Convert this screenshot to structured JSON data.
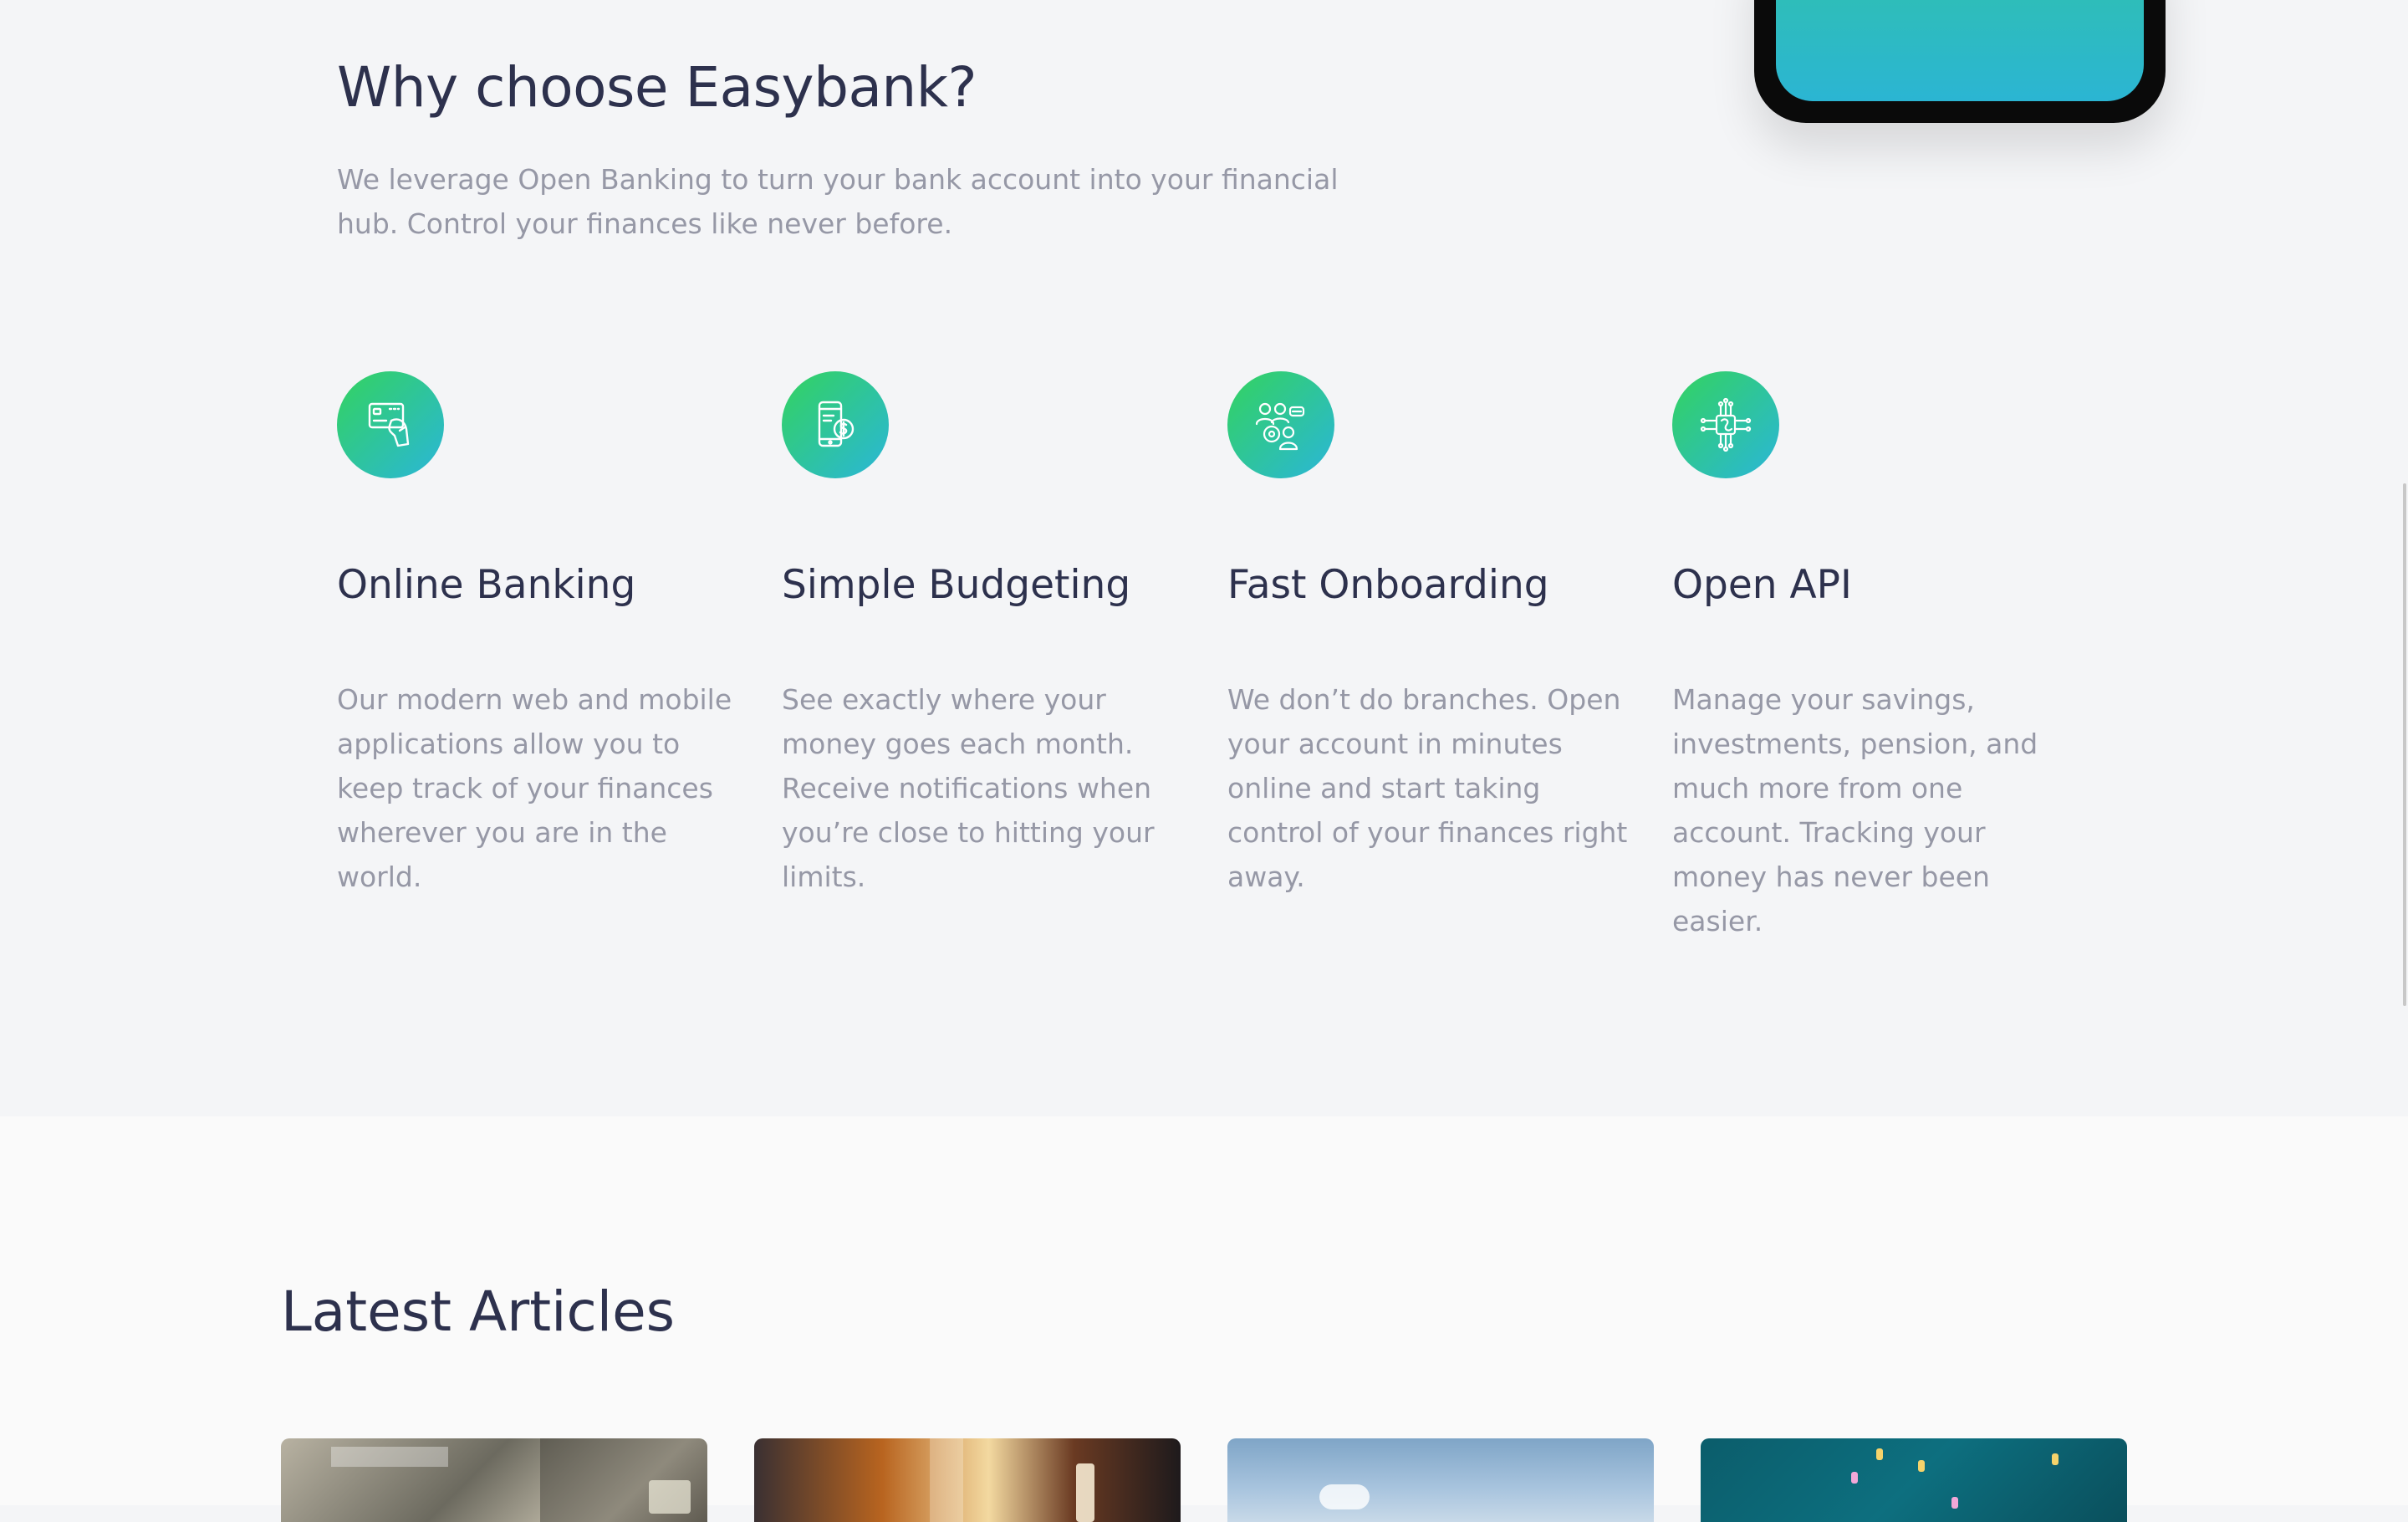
{
  "why": {
    "title": "Why choose Easybank?",
    "description": "We leverage Open Banking to turn your bank account into your financial hub. Control your finances like never before."
  },
  "features": [
    {
      "icon": "online-banking-icon",
      "title": "Online Banking",
      "text": "Our modern web and mobile applications allow you to keep track of your finances wherever you are in the world."
    },
    {
      "icon": "budgeting-icon",
      "title": "Simple Budgeting",
      "text": "See exactly where your money goes each month. Receive notifications when you’re close to hitting your limits."
    },
    {
      "icon": "onboarding-icon",
      "title": "Fast Onboarding",
      "text": "We don’t do branches. Open your account in minutes online and start taking control of your finances right away."
    },
    {
      "icon": "api-icon",
      "title": "Open API",
      "text": "Manage your savings, investments, pension, and much more from one account. Tracking your money has never been easier."
    }
  ],
  "articles": {
    "title": "Latest Articles",
    "cards": [
      {
        "image": "money-image"
      },
      {
        "image": "restaurant-image"
      },
      {
        "image": "plane-sky-image"
      },
      {
        "image": "confetti-image"
      }
    ]
  },
  "colors": {
    "dark_blue": "#2d314d",
    "grayish_blue": "#9698a6",
    "lime_green": "#33d35e",
    "bright_cyan": "#2ab6d9",
    "background": "#f4f5f7"
  }
}
